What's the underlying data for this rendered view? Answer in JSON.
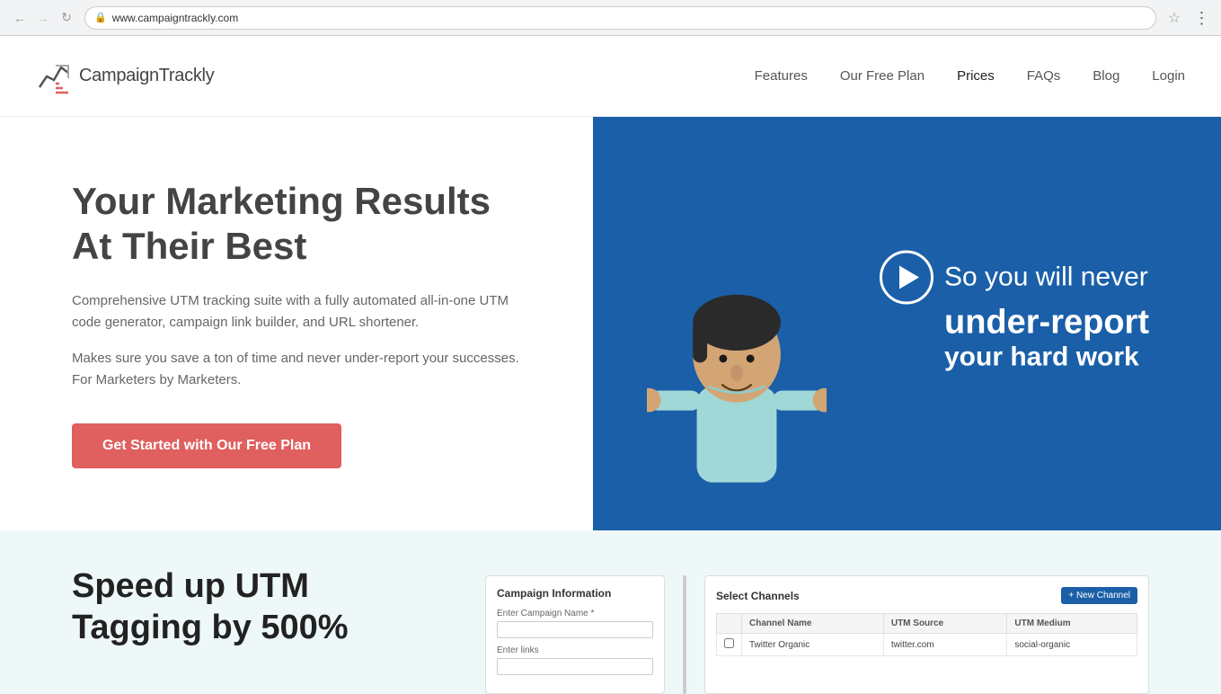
{
  "browser": {
    "url": "www.campaigntrackly.com",
    "back_disabled": false,
    "forward_disabled": false
  },
  "navbar": {
    "logo_text": "CampaignTrackly",
    "links": [
      {
        "label": "Features",
        "active": false
      },
      {
        "label": "Our Free Plan",
        "active": false
      },
      {
        "label": "Prices",
        "active": true
      },
      {
        "label": "FAQs",
        "active": false
      },
      {
        "label": "Blog",
        "active": false
      },
      {
        "label": "Login",
        "active": false
      }
    ]
  },
  "hero": {
    "title": "Your Marketing Results At Their Best",
    "description1": "Comprehensive UTM tracking suite with a fully automated all-in-one UTM code generator, campaign link builder, and URL shortener.",
    "description2": "Makes sure you save a ton of time and never under-report your successes. For Marketers by Marketers.",
    "cta_label": "Get Started with Our Free Plan",
    "video": {
      "line1": "So you will never",
      "line2": "under-report",
      "line3": "your hard work"
    }
  },
  "section2": {
    "title": "Speed up UTM Tagging by 500%",
    "campaign_panel": {
      "heading": "Campaign Information",
      "field1_label": "Enter Campaign Name *",
      "field2_label": "Enter links"
    },
    "channels_panel": {
      "heading": "Select Channels",
      "new_channel_label": "+ New Channel",
      "columns": [
        "",
        "Channel Name",
        "UTM Source",
        "UTM Medium"
      ],
      "rows": [
        {
          "name": "Twitter Organic",
          "source": "twitter.com",
          "medium": "social-organic"
        }
      ]
    }
  },
  "icons": {
    "lock": "🔒",
    "star": "☆",
    "menu": "⋮",
    "play": "▶",
    "chart": "📊",
    "back": "←",
    "forward": "→",
    "refresh": "↻"
  }
}
